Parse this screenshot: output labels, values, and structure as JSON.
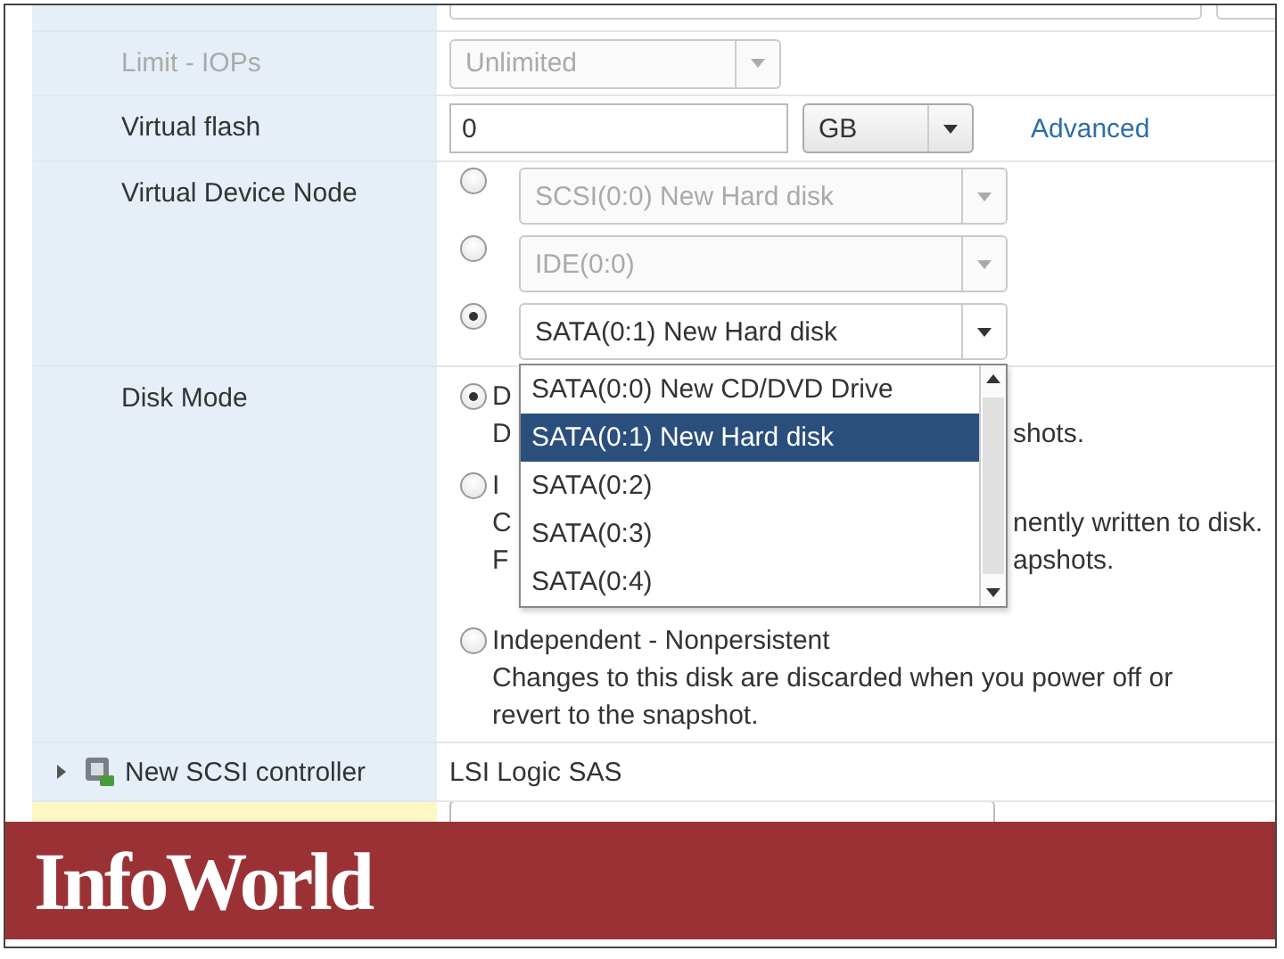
{
  "settings": [
    {
      "kind": "select",
      "label": "Limit - IOPs",
      "disabled": true,
      "value": "Unlimited"
    },
    {
      "kind": "input_unit",
      "label": "Virtual flash",
      "disabled": false,
      "value": "0",
      "unit": "GB",
      "link": "Advanced"
    },
    {
      "kind": "radio_selects",
      "label": "Virtual Device Node",
      "options": [
        {
          "selected": false,
          "disabled": true,
          "value": "SCSI(0:0) New Hard disk"
        },
        {
          "selected": false,
          "disabled": true,
          "value": "IDE(0:0)"
        },
        {
          "selected": true,
          "disabled": false,
          "value": "SATA(0:1) New Hard disk",
          "open": true
        }
      ],
      "dropdown": [
        {
          "label": "SATA(0:0) New CD/DVD Drive",
          "selected": false
        },
        {
          "label": "SATA(0:1) New Hard disk",
          "selected": true
        },
        {
          "label": "SATA(0:2)",
          "selected": false
        },
        {
          "label": "SATA(0:3)",
          "selected": false
        },
        {
          "label": "SATA(0:4)",
          "selected": false
        }
      ]
    },
    {
      "kind": "radios",
      "label": "Disk Mode",
      "options": [
        {
          "selected": true,
          "title": "D",
          "lines": [
            [
              "D",
              "shots."
            ]
          ]
        },
        {
          "selected": false,
          "title": "I",
          "lines": [
            [
              "C",
              "nently written to disk."
            ],
            [
              "F",
              "apshots."
            ]
          ]
        },
        {
          "selected": false,
          "title": "Independent - Nonpersistent",
          "lines": [
            [
              "Changes to this disk are discarded when you power off or"
            ],
            [
              "revert to the snapshot."
            ]
          ]
        }
      ]
    },
    {
      "kind": "device",
      "label": "New SCSI controller",
      "expanded": false,
      "value": "LSI Logic SAS"
    }
  ],
  "banner": {
    "logo": "InfoWorld"
  }
}
